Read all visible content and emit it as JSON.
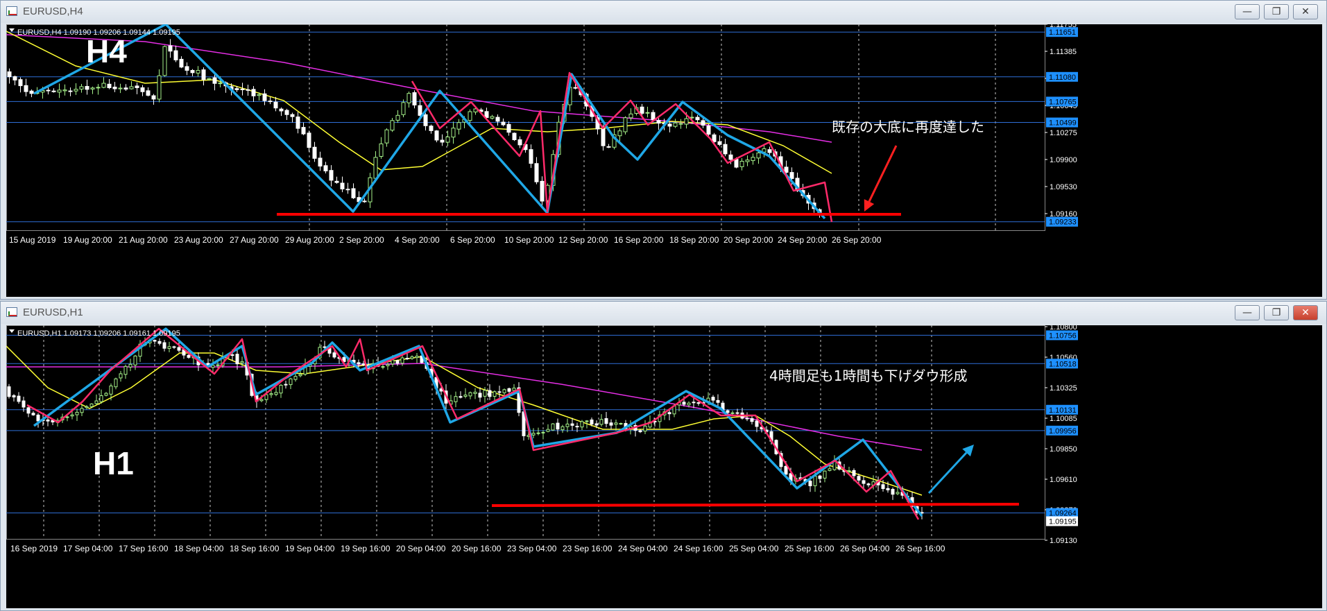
{
  "windows": [
    {
      "id": "h4",
      "title": "EURUSD,H4",
      "info_line": "EURUSD,H4  1.09190 1.09206 1.09144 1.09195",
      "big_label": "H4",
      "annotation": "既存の大底に再度達した",
      "price_ticks": [
        "1.11755",
        "1.11385",
        "1.11015",
        "1.10645",
        "1.10275",
        "1.09900",
        "1.09530",
        "1.09160"
      ],
      "hlines": [
        {
          "price": 1.11651,
          "label": "1.11651"
        },
        {
          "price": 1.1108,
          "label": "1.11080"
        },
        {
          "price": 1.10765,
          "label": "1.10765"
        },
        {
          "price": 1.10499,
          "label": "1.10499"
        },
        {
          "price": 1.09233,
          "label": "1.09233"
        }
      ],
      "date_labels": [
        "15 Aug 2019",
        "19 Aug 20:00",
        "21 Aug 20:00",
        "23 Aug 20:00",
        "27 Aug 20:00",
        "29 Aug 20:00",
        "2 Sep 20:00",
        "4 Sep 20:00",
        "6 Sep 20:00",
        "10 Sep 20:00",
        "12 Sep 20:00",
        "16 Sep 20:00",
        "18 Sep 20:00",
        "20 Sep 20:00",
        "24 Sep 20:00",
        "26 Sep 20:00"
      ]
    },
    {
      "id": "h1",
      "title": "EURUSD,H1",
      "info_line": "EURUSD,H1  1.09173 1.09206 1.09161 1.09195",
      "big_label": "H1",
      "annotation": "4時間足も1時間も下げダウ形成",
      "price_ticks": [
        "1.10800",
        "1.10560",
        "1.10325",
        "1.10085",
        "1.09850",
        "1.09610",
        "1.09370",
        "1.09130"
      ],
      "hlines": [
        {
          "price": 1.10756,
          "label": "1.10756"
        },
        {
          "price": 1.10518,
          "label": "1.10518"
        },
        {
          "price": 1.10131,
          "label": "1.10131"
        },
        {
          "price": 1.09956,
          "label": "1.09956"
        },
        {
          "price": 1.09264,
          "label": "1.09264"
        }
      ],
      "extra_label": "1.09195",
      "date_labels": [
        "16 Sep 2019",
        "17 Sep 04:00",
        "17 Sep 16:00",
        "18 Sep 04:00",
        "18 Sep 16:00",
        "19 Sep 04:00",
        "19 Sep 16:00",
        "20 Sep 04:00",
        "20 Sep 16:00",
        "23 Sep 04:00",
        "23 Sep 16:00",
        "24 Sep 04:00",
        "24 Sep 16:00",
        "25 Sep 04:00",
        "25 Sep 16:00",
        "26 Sep 04:00",
        "26 Sep 16:00"
      ]
    }
  ],
  "colors": {
    "background": "#000000",
    "bull_candle": "#a6f28a",
    "bear_candle": "#ffffff",
    "grid": "#c8c8c8",
    "hline": "#2f6fd8",
    "price_label_bg": "#1e90ff",
    "ma_fast": "#ffff33",
    "ma_slow": "#e62ee6",
    "zigzag_blue": "#1fa7e6",
    "zigzag_red": "#ff2a6a",
    "support_line": "#ff0000",
    "arrow_red": "#ff2020",
    "arrow_blue": "#1fa7e6"
  }
}
